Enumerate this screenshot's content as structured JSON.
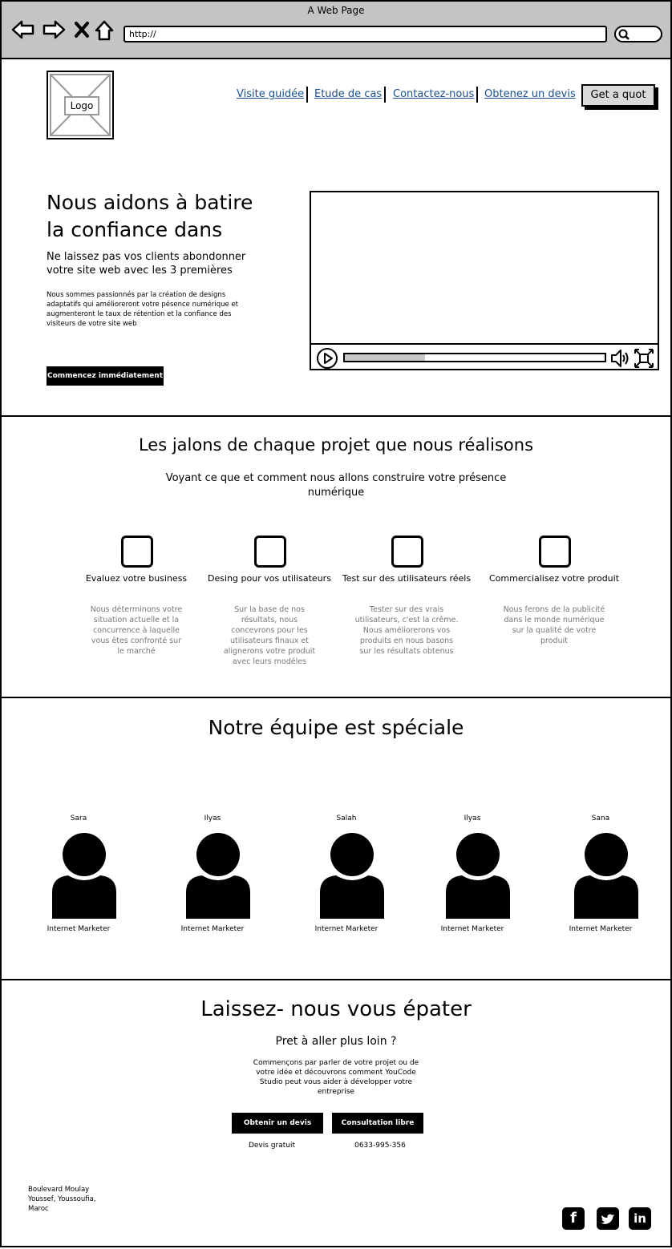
{
  "browser": {
    "title": "A Web Page",
    "url": "http://"
  },
  "header": {
    "logo_label": "Logo",
    "nav": [
      "Visite guidée",
      "Etude de cas",
      "Contactez-nous",
      "Obtenez un devis"
    ],
    "cta_label": "Get a quot"
  },
  "hero": {
    "title_line1": "Nous aidons à batire",
    "title_line2": "la confiance dans",
    "subtitle_line1": "Ne laissez pas vos clients abondonner",
    "subtitle_line2": "votre site web avec les 3 premières",
    "body_lines": [
      "Nous sommes passionnés par la création de designs",
      "adaptatifs qui amélioreront votre pésence numérique et",
      "augmenteront le taux de rétention et la confiance des",
      "visiteurs de votre site web"
    ],
    "button_label": "Commencez immédiatement",
    "video_progress": 0.31
  },
  "milestones": {
    "title": "Les jalons de chaque projet que nous réalisons",
    "subtitle_line1": "Voyant ce que et comment nous allons construire votre présence",
    "subtitle_line2": "numérique",
    "items": [
      {
        "title": "Evaluez votre business",
        "lines": [
          "Nous déterminons votre",
          "situation actuelle et la",
          "concurrence à laquelle",
          "vous êtes confronté sur",
          "le marché"
        ]
      },
      {
        "title": "Desing pour vos utilisateurs",
        "lines": [
          "Sur la base de nos",
          "résultats, nous",
          "concevrons pour les",
          "utilisateurs finaux et",
          "alignerons votre produit",
          "avec leurs modéles"
        ]
      },
      {
        "title": "Test sur des utilisateurs réels",
        "lines": [
          "Tester sur des vrais",
          "utilisateurs, c'est la crême.",
          "Nous améliorerons vos",
          "produits en nous basons",
          "sur les résultats obtenus"
        ]
      },
      {
        "title": "Commercialisez votre produit",
        "lines": [
          "Nous ferons de la publicité",
          "dans le monde numérique",
          "sur la qualité de votre",
          "produit"
        ]
      }
    ]
  },
  "team": {
    "title": "Notre équipe est spéciale",
    "members": [
      {
        "name": "Sara",
        "role": "Internet Marketer"
      },
      {
        "name": "Ilyas",
        "role": "Internet Marketer"
      },
      {
        "name": "Salah",
        "role": "Internet Marketer"
      },
      {
        "name": "Ilyas",
        "role": "Internet Marketer"
      },
      {
        "name": "Sana",
        "role": "Internet Marketer"
      }
    ]
  },
  "cta_section": {
    "title": "Laissez- nous vous épater",
    "subtitle": "Pret à aller plus loin ?",
    "body_lines": [
      "Commençons par parler de votre projet ou de",
      "votre idée et découvrons comment YouCode",
      "Studio peut vous aider à développer votre",
      "entreprise"
    ],
    "button1_label": "Obtenir un devis",
    "button2_label": "Consultation libre",
    "note1": "Devis gratuit",
    "note2": "0633-995-356"
  },
  "footer": {
    "address_lines": [
      "Boulevard Moulay",
      "Youssef, Youssoufia,",
      "Maroc"
    ],
    "social_icons": [
      "facebook-icon",
      "twitter-icon",
      "linkedin-icon"
    ]
  }
}
